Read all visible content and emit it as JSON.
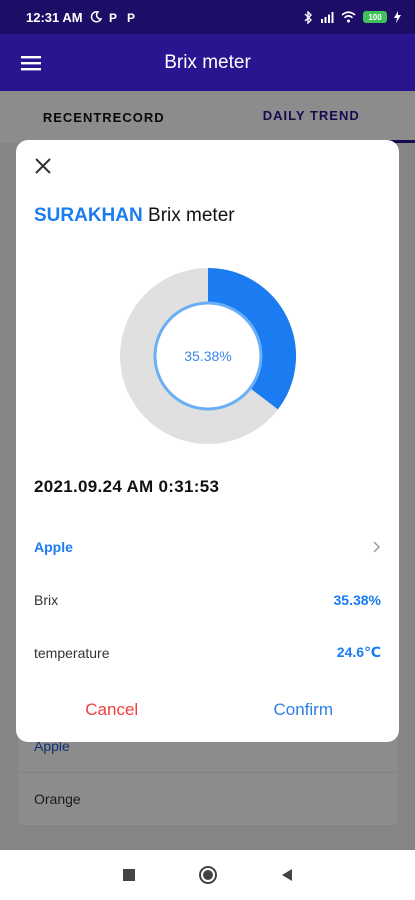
{
  "status_bar": {
    "time": "12:31 AM",
    "battery": "100"
  },
  "app_bar": {
    "title": "Brix meter"
  },
  "tabs": [
    {
      "label": "RECENTRECORD",
      "active": false
    },
    {
      "label": "DAILY TREND",
      "active": true
    }
  ],
  "background_list": [
    {
      "label": "Apple"
    },
    {
      "label": "Orange"
    }
  ],
  "dialog": {
    "brand": "SURAKHAN",
    "title_suffix": "Brix meter",
    "donut": {
      "percent_label": "35.38%",
      "fraction": 0.3538,
      "fill_color": "#1a7cf0",
      "track_color": "#e0e0e0"
    },
    "datetime": "2021.09.24 AM 0:31:53",
    "fruit": "Apple",
    "brix_label": "Brix",
    "brix_value": "35.38%",
    "temperature_label": "temperature",
    "temperature_value": "24.6℃",
    "cancel_label": "Cancel",
    "confirm_label": "Confirm"
  },
  "colors": {
    "primary": "#2a1591",
    "accent": "#1a7cf0",
    "cancel": "#f04040"
  },
  "icons": [
    "moon-icon",
    "p-icon",
    "bluetooth-icon",
    "signal-icon",
    "wifi-icon",
    "charging-icon",
    "menu-icon",
    "close-icon",
    "chevron-right-icon",
    "stop-icon",
    "home-icon",
    "back-icon"
  ]
}
